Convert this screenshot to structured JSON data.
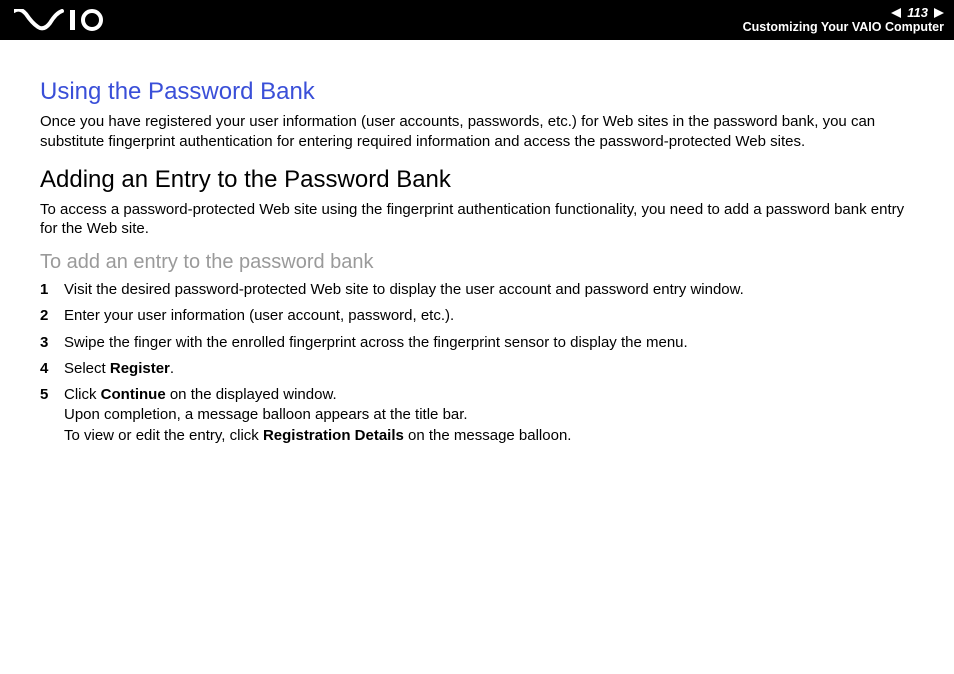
{
  "header": {
    "page_number": "113",
    "breadcrumb": "Customizing Your VAIO Computer"
  },
  "section1": {
    "title": "Using the Password Bank",
    "body": "Once you have registered your user information (user accounts, passwords, etc.) for Web sites in the password bank, you can substitute fingerprint authentication for entering required information and access the password-protected Web sites."
  },
  "section2": {
    "title": "Adding an Entry to the Password Bank",
    "body": "To access a password-protected Web site using the fingerprint authentication functionality, you need to add a password bank entry for the Web site."
  },
  "procedure": {
    "title": "To add an entry to the password bank",
    "steps": {
      "s1": "Visit the desired password-protected Web site to display the user account and password entry window.",
      "s2": "Enter your user information (user account, password, etc.).",
      "s3": "Swipe the finger with the enrolled fingerprint across the fingerprint sensor to display the menu.",
      "s4_pre": "Select ",
      "s4_bold": "Register",
      "s4_post": ".",
      "s5_pre": "Click ",
      "s5_bold1": "Continue",
      "s5_mid1": " on the displayed window.",
      "s5_line2": "Upon completion, a message balloon appears at the title bar.",
      "s5_line3_pre": "To view or edit the entry, click ",
      "s5_bold2": "Registration Details",
      "s5_line3_post": " on the message balloon."
    },
    "nums": {
      "n1": "1",
      "n2": "2",
      "n3": "3",
      "n4": "4",
      "n5": "5"
    }
  }
}
